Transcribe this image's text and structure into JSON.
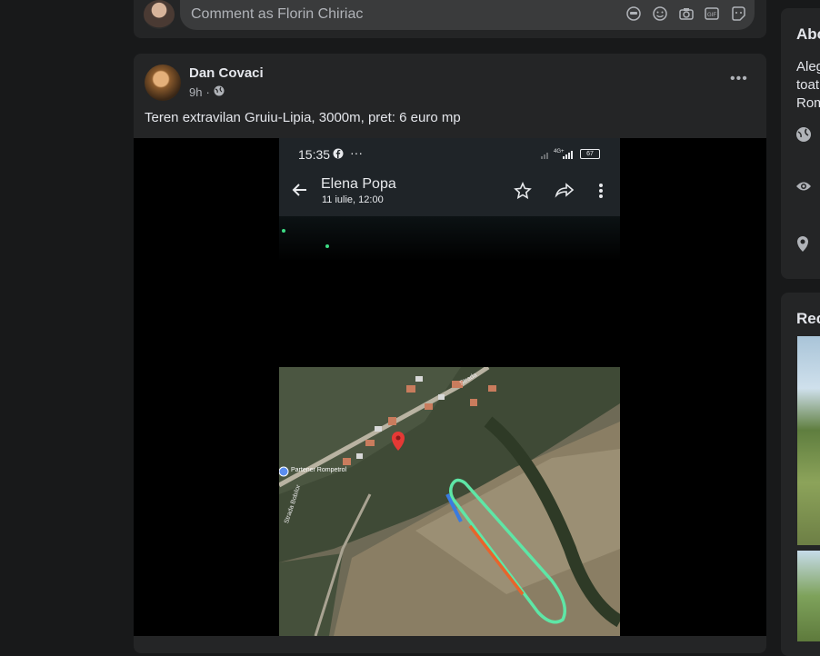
{
  "comment": {
    "placeholder": "Comment as Florin Chiriac",
    "icons": [
      "avatar-icon",
      "emoji-icon",
      "camera-icon",
      "gif-icon",
      "sticker-icon"
    ]
  },
  "post": {
    "author": "Dan Covaci",
    "time": "9h",
    "text": "Teren extravilan Gruiu-Lipia, 3000m, pret: 6 euro mp",
    "more": "•••"
  },
  "phone": {
    "time": "15:35",
    "status": "···",
    "network": "4G+",
    "battery": "67",
    "contact": "Elena Popa",
    "date": "11 iulie, 12:00"
  },
  "map": {
    "poi": "Partener Rompetrol",
    "street": "Strada Bobilor",
    "road": "Strada"
  },
  "sidebar": {
    "about_title": "Abo",
    "about_lines": [
      "Aleg",
      "toat",
      "Rom"
    ],
    "recent_title": "Rec"
  }
}
